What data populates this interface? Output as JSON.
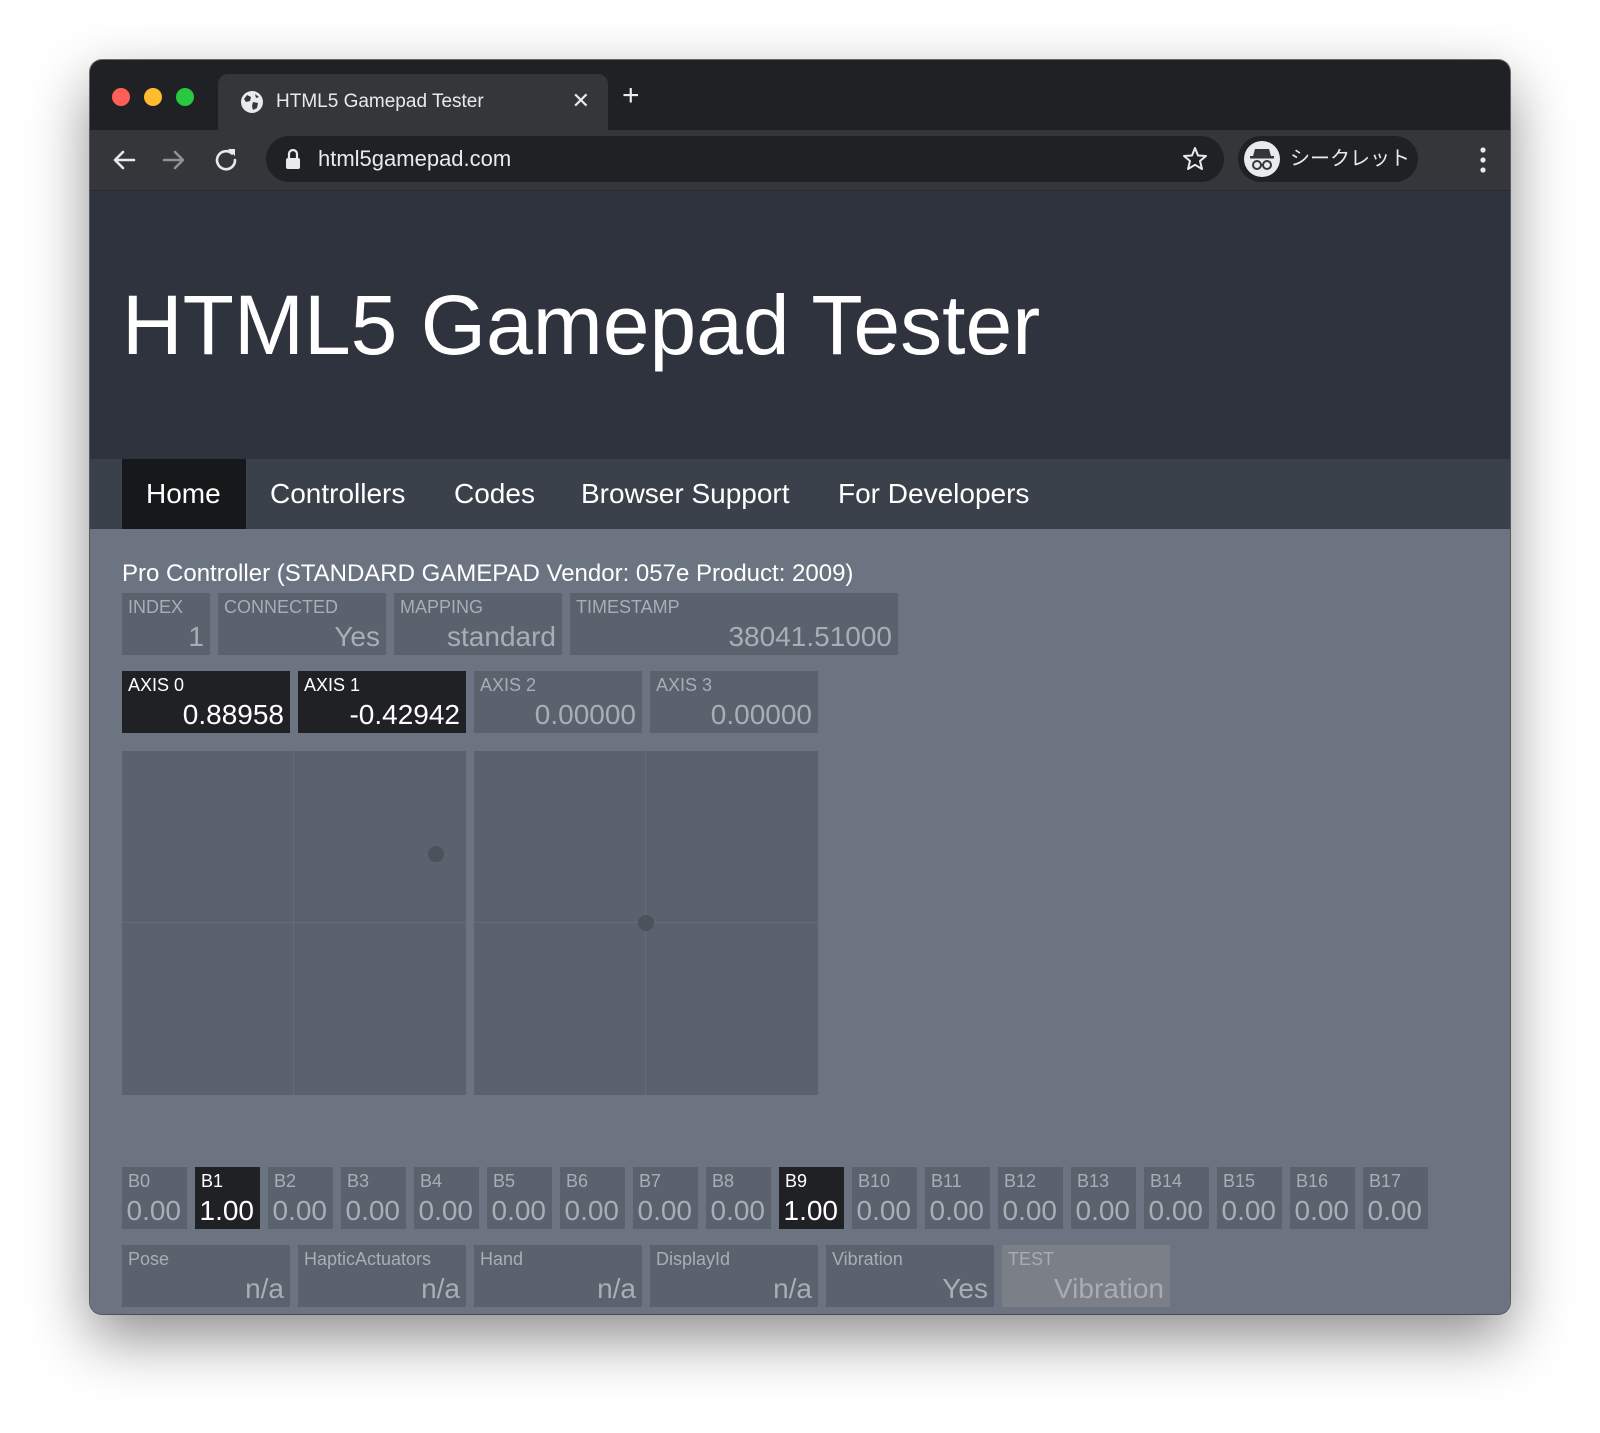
{
  "browser": {
    "tab_title": "HTML5 Gamepad Tester",
    "tab_close_glyph": "✕",
    "new_tab_glyph": "+",
    "url": "html5gamepad.com",
    "incognito_label": "シークレット",
    "icons": [
      "globe-icon",
      "close-icon",
      "plus-icon",
      "back-arrow-icon",
      "forward-arrow-icon",
      "reload-icon",
      "lock-icon",
      "star-icon",
      "incognito-icon",
      "kebab-menu-icon"
    ]
  },
  "page": {
    "title": "HTML5 Gamepad Tester",
    "nav": [
      {
        "label": "Home",
        "active": true
      },
      {
        "label": "Controllers",
        "active": false
      },
      {
        "label": "Codes",
        "active": false
      },
      {
        "label": "Browser Support",
        "active": false
      },
      {
        "label": "For Developers",
        "active": false
      }
    ]
  },
  "gamepad": {
    "name": "Pro Controller (STANDARD GAMEPAD Vendor: 057e Product: 2009)",
    "info": [
      {
        "label": "INDEX",
        "value": "1"
      },
      {
        "label": "CONNECTED",
        "value": "Yes"
      },
      {
        "label": "MAPPING",
        "value": "standard"
      },
      {
        "label": "TIMESTAMP",
        "value": "38041.51000"
      }
    ],
    "axes": [
      {
        "label": "AXIS 0",
        "value": "0.88958",
        "active": true
      },
      {
        "label": "AXIS 1",
        "value": "-0.42942",
        "active": true
      },
      {
        "label": "AXIS 2",
        "value": "0.00000",
        "active": false
      },
      {
        "label": "AXIS 3",
        "value": "0.00000",
        "active": false
      }
    ],
    "sticks": [
      {
        "x": 0.88958,
        "y": -0.42942
      },
      {
        "x": 0.0,
        "y": 0.0
      }
    ],
    "buttons": [
      {
        "label": "B0",
        "value": "0.00",
        "active": false
      },
      {
        "label": "B1",
        "value": "1.00",
        "active": true
      },
      {
        "label": "B2",
        "value": "0.00",
        "active": false
      },
      {
        "label": "B3",
        "value": "0.00",
        "active": false
      },
      {
        "label": "B4",
        "value": "0.00",
        "active": false
      },
      {
        "label": "B5",
        "value": "0.00",
        "active": false
      },
      {
        "label": "B6",
        "value": "0.00",
        "active": false
      },
      {
        "label": "B7",
        "value": "0.00",
        "active": false
      },
      {
        "label": "B8",
        "value": "0.00",
        "active": false
      },
      {
        "label": "B9",
        "value": "1.00",
        "active": true
      },
      {
        "label": "B10",
        "value": "0.00",
        "active": false
      },
      {
        "label": "B11",
        "value": "0.00",
        "active": false
      },
      {
        "label": "B12",
        "value": "0.00",
        "active": false
      },
      {
        "label": "B13",
        "value": "0.00",
        "active": false
      },
      {
        "label": "B14",
        "value": "0.00",
        "active": false
      },
      {
        "label": "B15",
        "value": "0.00",
        "active": false
      },
      {
        "label": "B16",
        "value": "0.00",
        "active": false
      },
      {
        "label": "B17",
        "value": "0.00",
        "active": false
      }
    ],
    "extras": [
      {
        "label": "Pose",
        "value": "n/a"
      },
      {
        "label": "HapticActuators",
        "value": "n/a"
      },
      {
        "label": "Hand",
        "value": "n/a"
      },
      {
        "label": "DisplayId",
        "value": "n/a"
      },
      {
        "label": "Vibration",
        "value": "Yes"
      }
    ],
    "test": {
      "label": "TEST",
      "value": "Vibration"
    }
  },
  "colors": {
    "page_bg": "#6b7480",
    "hero_bg": "#2e333d",
    "nav_bg": "#3b414b",
    "active_bg": "#202124",
    "cell_bg": "#5b626d"
  }
}
